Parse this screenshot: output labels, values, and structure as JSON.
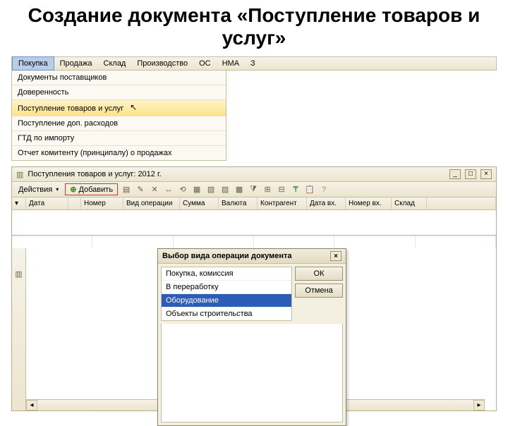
{
  "title": "Создание документа «Поступление товаров и услуг»",
  "menu": {
    "items": [
      "Покупка",
      "Продажа",
      "Склад",
      "Производство",
      "ОС",
      "НМА",
      "З"
    ]
  },
  "dropdown": {
    "items": [
      "Документы поставщиков",
      "Доверенность",
      "Поступление товаров и услуг",
      "Поступление доп. расходов",
      "ГТД по импорту",
      "Отчет комитенту (принципалу) о продажах"
    ]
  },
  "listWindow": {
    "title": "Поступления товаров и услуг: 2012 г.",
    "actions": "Действия",
    "addLabel": "Добавить",
    "columns": [
      "",
      "Дата",
      "",
      "Номер",
      "Вид операции",
      "Сумма",
      "Валюта",
      "Контрагент",
      "Дата вх.",
      "Номер вх.",
      "Склад",
      ""
    ]
  },
  "dialog": {
    "title": "Выбор вида операции документа",
    "items": [
      "Покупка, комиссия",
      "В переработку",
      "Оборудование",
      "Объекты строительства"
    ],
    "ok": "ОК",
    "cancel": "Отмена"
  }
}
